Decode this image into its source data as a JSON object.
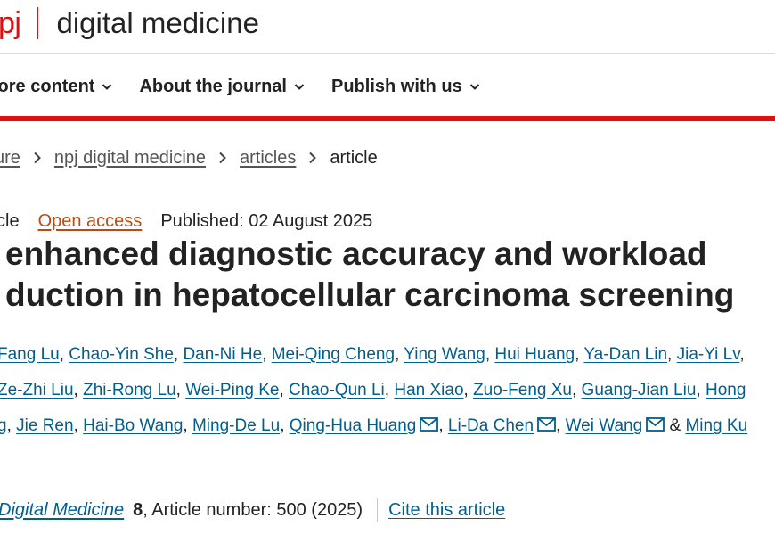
{
  "header": {
    "logo_npj": "pj",
    "journal_title": "digital medicine"
  },
  "nav": {
    "items": [
      "lore content",
      "About the journal",
      "Publish with us"
    ]
  },
  "breadcrumb": {
    "items": [
      "ure",
      "npj digital medicine",
      "articles"
    ],
    "current": "article"
  },
  "meta": {
    "type": "cle",
    "open_access": "Open access",
    "published": "Published: 02 August 2025"
  },
  "title": {
    "line1": "enhanced diagnostic accuracy and workload",
    "line2": "duction in hepatocellular carcinoma screening"
  },
  "authors": {
    "row1": [
      "Fang Lu",
      "Chao-Yin She",
      "Dan-Ni He",
      "Mei-Qing Cheng",
      "Ying Wang",
      "Hui Huang",
      "Ya-Dan Lin",
      "Jia-Yi Lv"
    ],
    "row1_end": ",",
    "row2": [
      "Ze-Zhi Liu",
      "Zhi-Rong Lu",
      "Wei-Ping Ke",
      "Chao-Qun Li",
      "Han Xiao",
      "Zuo-Feng Xu",
      "Guang-Jian Liu",
      "Hong"
    ],
    "row3_lead": "g",
    "row3": [
      "Jie Ren",
      "Hai-Bo Wang",
      "Ming-De Lu",
      "Qing-Hua Huang",
      "Li-Da Chen",
      "Wei Wang"
    ],
    "row3_amp": "&",
    "row3_last": "Ming Ku"
  },
  "citation": {
    "journal": "Digital Medicine",
    "volume": "8",
    "article": ", Article number: 500 (2025)",
    "cite": "Cite this article"
  },
  "colors": {
    "brand_red": "#e10f0f",
    "link_blue": "#025e8d",
    "open_access_orange": "#b84d14"
  }
}
